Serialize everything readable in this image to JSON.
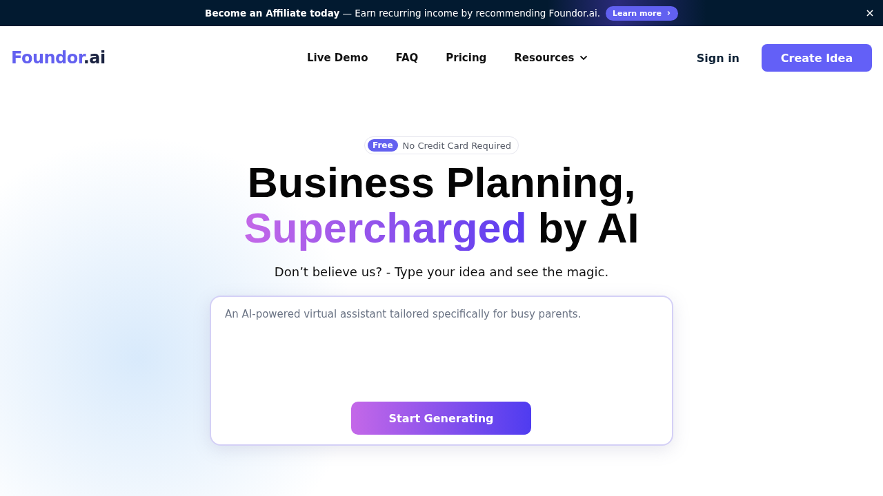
{
  "banner": {
    "text": "**Become an Affiliate today** — Earn recurring income by recommending Foundor.ai.",
    "link": "Learn more"
  },
  "header": {
    "logo": {
      "name": "Foundor",
      "suffix": ".ai"
    },
    "nav": [
      {
        "label": "Live Demo",
        "kind": "link"
      },
      {
        "label": "FAQ",
        "kind": "link"
      },
      {
        "label": "Pricing",
        "kind": "link"
      },
      {
        "label": "Resources",
        "kind": "dropdown"
      }
    ],
    "sign_in": "Sign in",
    "cta": "Create Idea"
  },
  "hero": {
    "badge": {
      "tag": "Free",
      "text": "No Credit Card Required"
    },
    "headline": {
      "line1": "Business Planning,",
      "highlight": "Supercharged",
      "rest": "by AI"
    },
    "subtitle": "Don’t believe us? - Type your idea and see the magic.",
    "idea_field": {
      "placeholder": "An AI-powered virtual assistant tailored specifically for busy parents."
    },
    "button": "Start Generating"
  }
}
